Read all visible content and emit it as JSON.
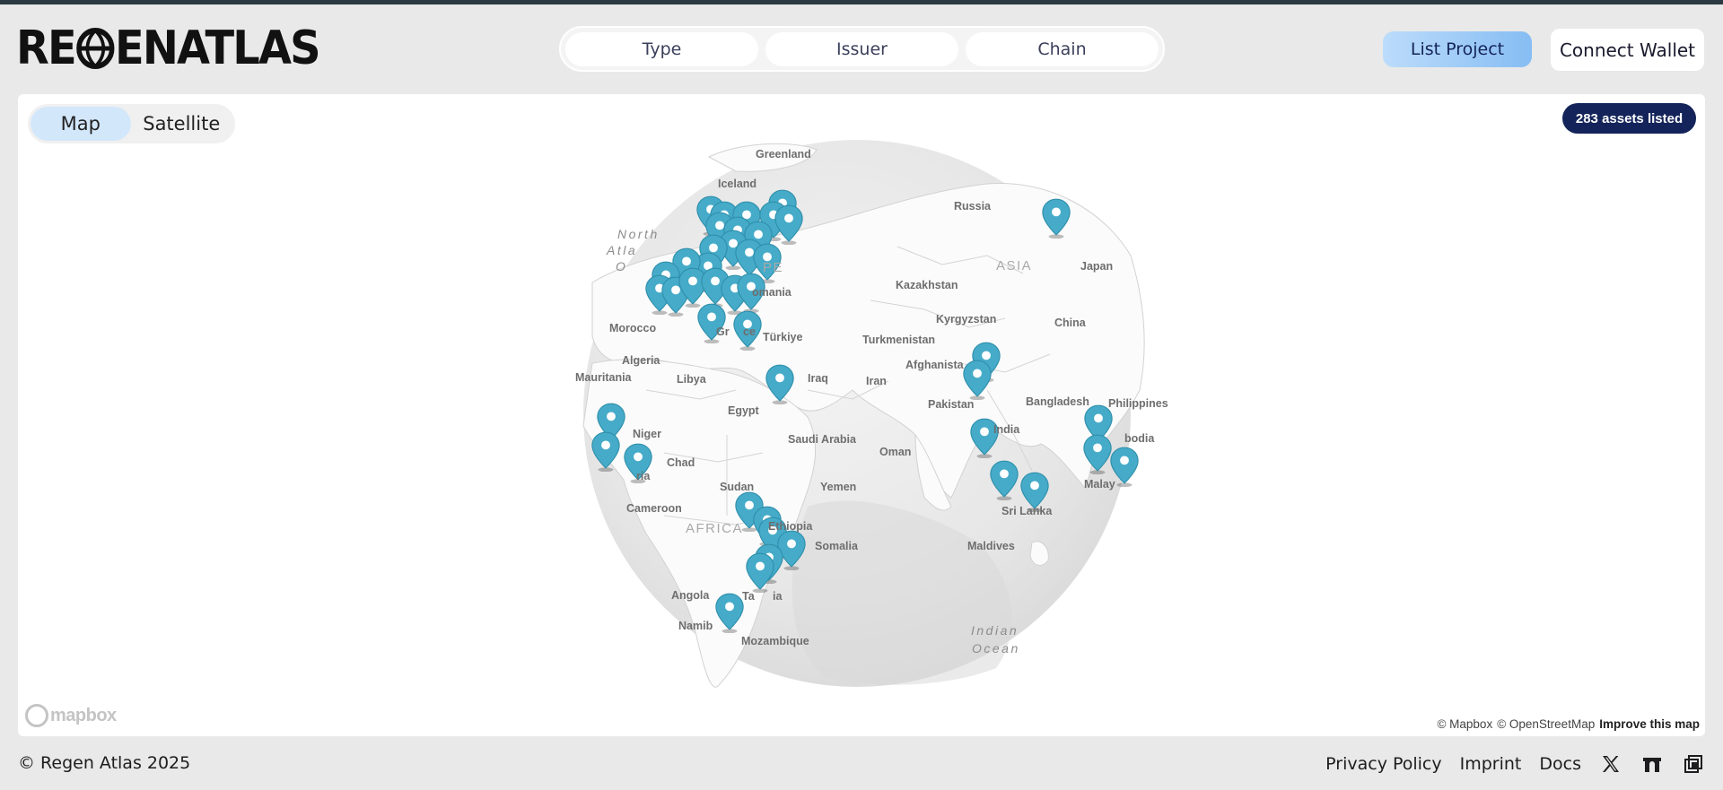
{
  "brand": {
    "logo_text_left": "RE",
    "logo_text_right": "ENATLAS"
  },
  "filters": [
    {
      "label": "Type"
    },
    {
      "label": "Issuer"
    },
    {
      "label": "Chain"
    }
  ],
  "actions": {
    "list_project": "List Project",
    "connect_wallet": "Connect Wallet"
  },
  "map": {
    "view_toggle": {
      "map": "Map",
      "satellite": "Satellite",
      "selected": "Map"
    },
    "assets_badge": "283 assets listed",
    "pin_color": "#45abc8",
    "labels": {
      "greenland": "Greenland",
      "iceland": "Iceland",
      "russia": "Russia",
      "north_atlantic": "North",
      "north_atlantic_2": "Atla",
      "north_atlantic_3": "O",
      "europe": "PE",
      "asia": "ASIA",
      "japan": "Japan",
      "kazakhstan": "Kazakhstan",
      "romania": "omania",
      "kyrgyzstan": "Kyrgyzstan",
      "china": "China",
      "morocco": "Morocco",
      "greece": "Gr",
      "greece_2": "ce",
      "turkiye": "Türkiye",
      "turkmenistan": "Turkmenistan",
      "algeria": "Algeria",
      "afghanistan": "Afghanista",
      "mauritania": "Mauritania",
      "libya": "Libya",
      "iraq": "Iraq",
      "iran": "Iran",
      "pakistan": "Pakistan",
      "bangladesh": "Bangladesh",
      "philippines": "Philippines",
      "egypt": "Egypt",
      "india": "India",
      "niger": "Niger",
      "saudi_arabia": "Saudi Arabia",
      "cambodia": "bodia",
      "chad": "Chad",
      "oman": "Oman",
      "nigeria": "ria",
      "malaysia": "Malay",
      "sudan": "Sudan",
      "yemen": "Yemen",
      "sri_lanka": "Sri Lanka",
      "cameroon": "Cameroon",
      "ethiopia": "Ethiopia",
      "africa": "AFRICA",
      "somalia": "Somalia",
      "maldives": "Maldives",
      "angola": "Angola",
      "tanzania": "Ta",
      "tanzania_2": "ia",
      "namibia": "Namib",
      "mozambique": "Mozambique",
      "indian_ocean": "Indian",
      "indian_ocean_2": "Ocean"
    },
    "mapbox_logo": "mapbox",
    "attribution": {
      "mapbox": "© Mapbox",
      "osm": "© OpenStreetMap",
      "improve": "Improve this map"
    }
  },
  "footer": {
    "copyright": "© Regen Atlas 2025",
    "links": [
      {
        "label": "Privacy Policy"
      },
      {
        "label": "Imprint"
      },
      {
        "label": "Docs"
      }
    ],
    "icons": [
      "x-icon",
      "gitbook-arch-icon",
      "paragraph-mirror-icon"
    ]
  }
}
